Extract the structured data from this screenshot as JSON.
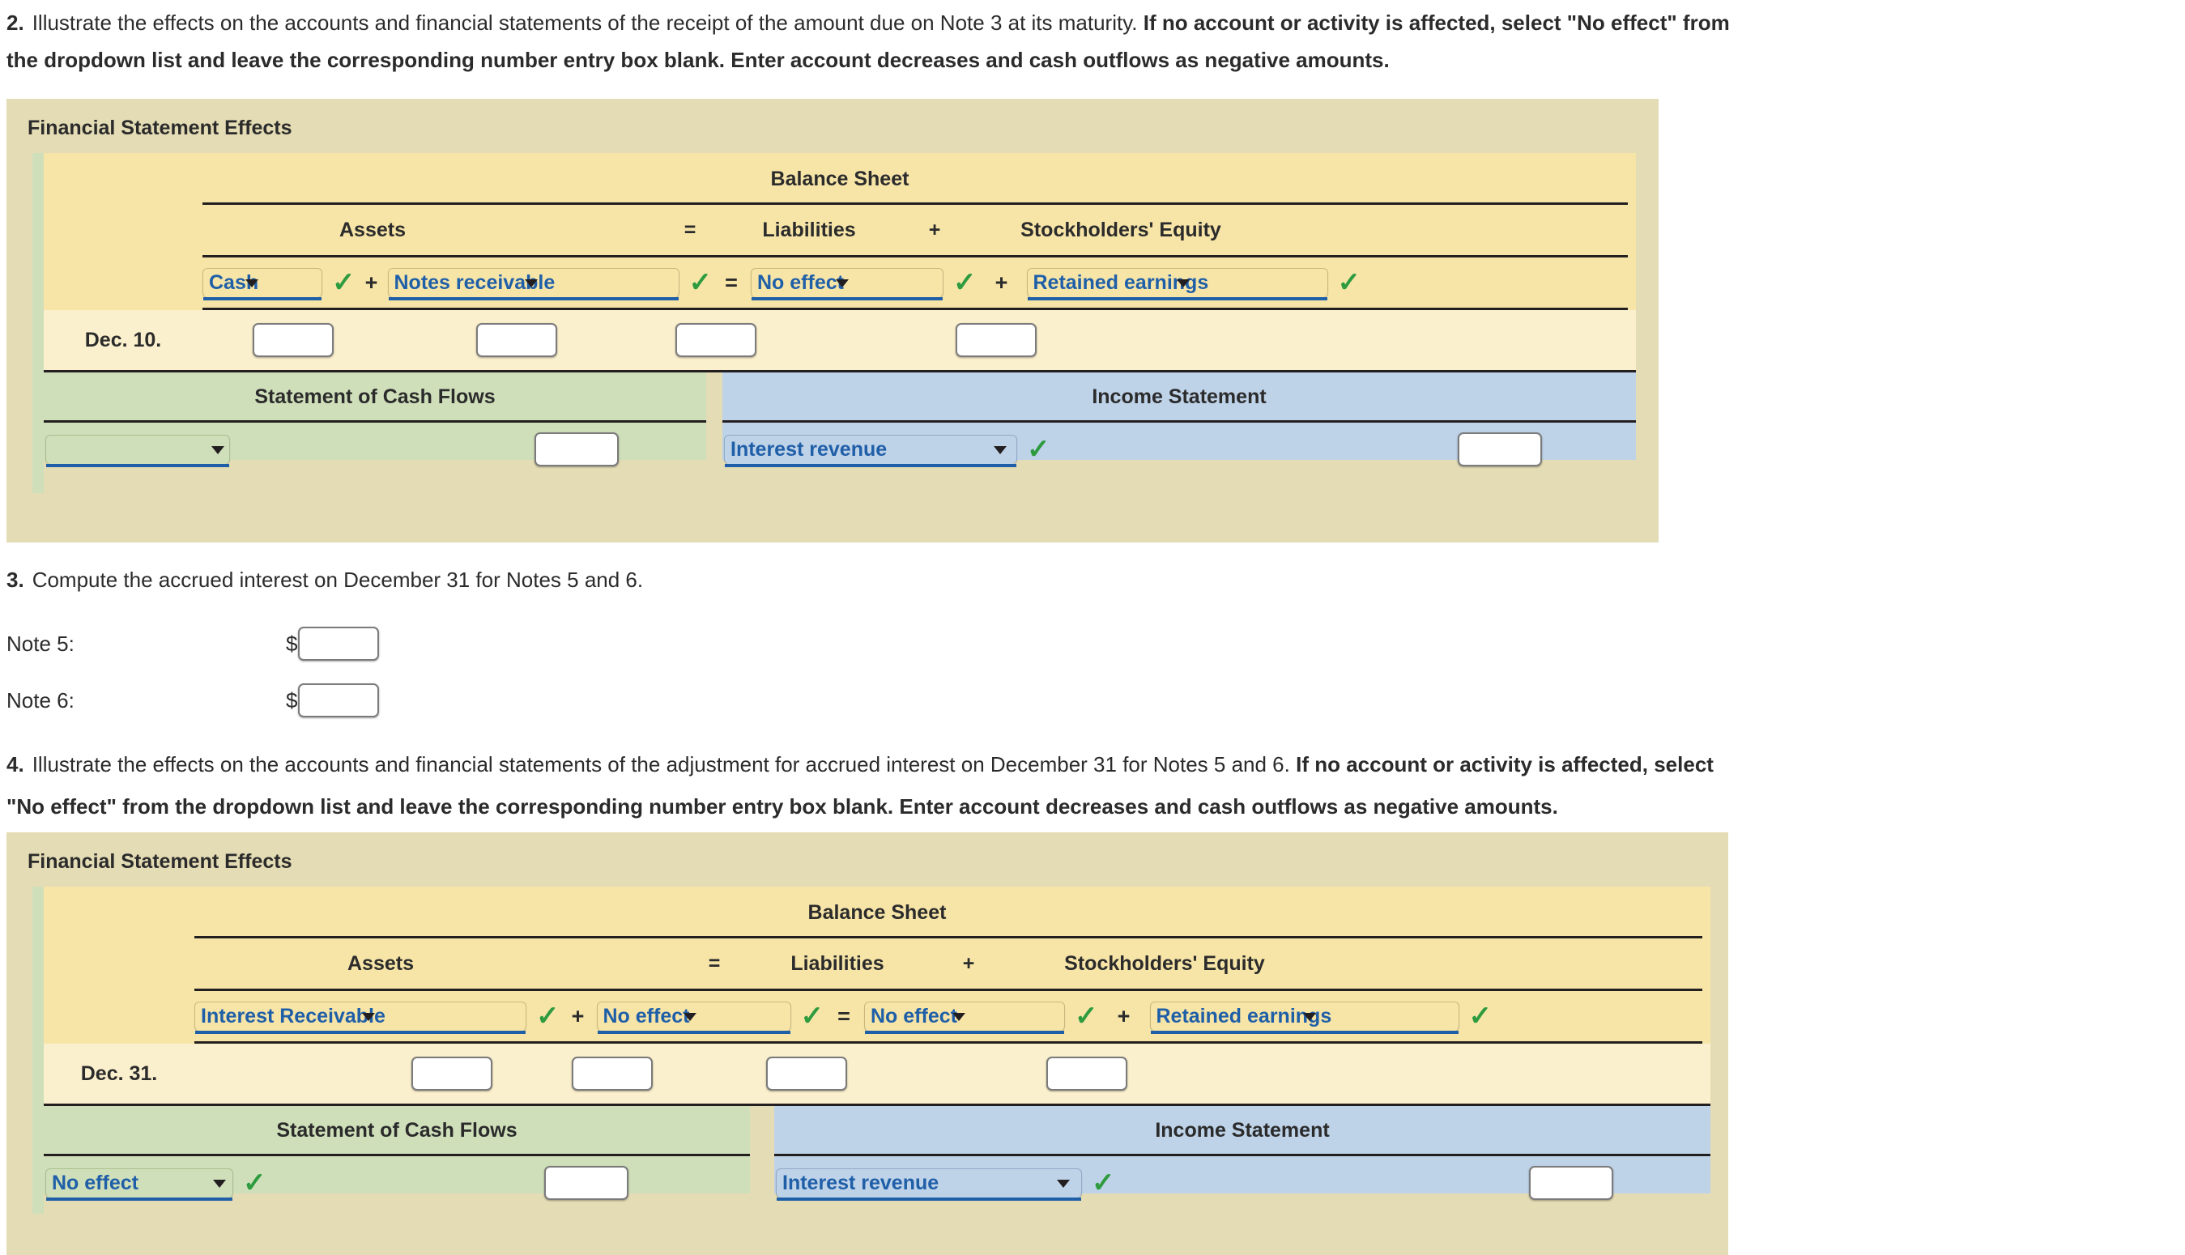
{
  "questions": {
    "q2": {
      "number": "2.",
      "line1_plain": "Illustrate the effects on the accounts and financial statements of the receipt of the amount due on Note 3 at its maturity.",
      "line1_bold": "If no account or activity is affected, select \"No effect\" from",
      "line2_bold": "the dropdown list and leave the corresponding number entry box blank. Enter account decreases and cash outflows as negative amounts."
    },
    "q3": {
      "number": "3.",
      "text": "Compute the accrued interest on December 31 for Notes 5 and 6.",
      "rows": [
        {
          "label": "Note 5:",
          "currency": "$",
          "value": ""
        },
        {
          "label": "Note 6:",
          "currency": "$",
          "value": ""
        }
      ]
    },
    "q4": {
      "number": "4.",
      "line1_plain": "Illustrate the effects on the accounts and financial statements of the adjustment for accrued interest on December 31 for Notes 5 and 6.",
      "line1_bold": "If no account or activity is affected, select",
      "line2_bold": "\"No effect\" from the dropdown list and leave the corresponding number entry box blank. Enter account decreases and cash outflows as negative amounts."
    }
  },
  "panel1": {
    "title": "Financial Statement Effects",
    "balance_sheet_title": "Balance Sheet",
    "column_headers": {
      "assets": "Assets",
      "equals": "=",
      "liabilities": "Liabilities",
      "plus": "+",
      "stockholders_equity": "Stockholders' Equity"
    },
    "operators": {
      "plus1": "+",
      "equals": "=",
      "plus2": "+"
    },
    "accounts": {
      "asset1": "Cash",
      "asset2": "Notes receivable",
      "liability": "No effect",
      "equity": "Retained earnings"
    },
    "checks": {
      "asset1": "✓",
      "asset2": "✓",
      "liability": "✓",
      "equity": "✓"
    },
    "date_label": "Dec. 10.",
    "entries": {
      "asset1": "",
      "asset2": "",
      "liability": "",
      "equity": ""
    },
    "cash_flows": {
      "title": "Statement of Cash Flows",
      "selected": "",
      "amount": ""
    },
    "income_statement": {
      "title": "Income Statement",
      "selected": "Interest revenue",
      "check": "✓",
      "amount": ""
    }
  },
  "panel2": {
    "title": "Financial Statement Effects",
    "balance_sheet_title": "Balance Sheet",
    "column_headers": {
      "assets": "Assets",
      "equals": "=",
      "liabilities": "Liabilities",
      "plus": "+",
      "stockholders_equity": "Stockholders' Equity"
    },
    "operators": {
      "plus1": "+",
      "equals": "=",
      "plus2": "+"
    },
    "accounts": {
      "asset1": "Interest Receivable",
      "asset2": "No effect",
      "liability": "No effect",
      "equity": "Retained earnings"
    },
    "checks": {
      "asset1": "✓",
      "asset2": "✓",
      "liability": "✓",
      "equity": "✓"
    },
    "date_label": "Dec. 31.",
    "entries": {
      "asset1": "",
      "asset2": "",
      "liability": "",
      "equity": ""
    },
    "cash_flows": {
      "title": "Statement of Cash Flows",
      "selected": "No effect",
      "check": "✓",
      "amount": ""
    },
    "income_statement": {
      "title": "Income Statement",
      "selected": "Interest revenue",
      "check": "✓",
      "amount": ""
    }
  },
  "colors": {
    "panel_outer": "#e4dcb4",
    "balance_sheet_bg": "#f7e5a8",
    "date_row_bg": "#fbf0cd",
    "cash_flows_bg": "#cfdfba",
    "income_statement_bg": "#bed2e8",
    "dropdown_text": "#1f5fa8",
    "check_green": "#2e9b3f",
    "text": "#2b2b2b"
  }
}
